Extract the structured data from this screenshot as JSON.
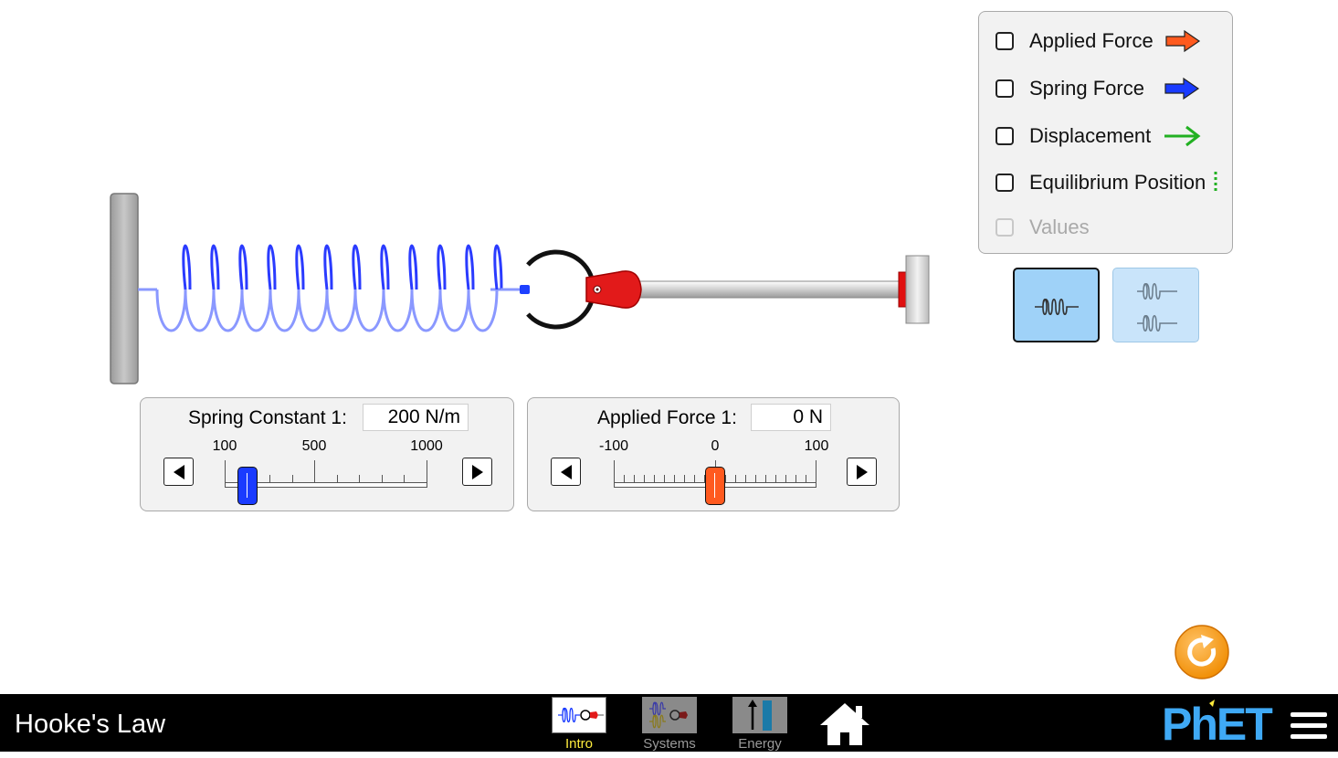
{
  "options": {
    "applied_force": "Applied Force",
    "spring_force": "Spring Force",
    "displacement": "Displacement",
    "equilibrium_position": "Equilibrium Position",
    "values": "Values"
  },
  "spring_constant": {
    "title": "Spring Constant 1:",
    "value": "200 N/m",
    "tick_min": "100",
    "tick_mid": "500",
    "tick_max": "1000",
    "level": 200,
    "range": [
      100,
      1000
    ]
  },
  "applied_force": {
    "title": "Applied Force 1:",
    "value": "0 N",
    "tick_min": "-100",
    "tick_mid": "0",
    "tick_max": "100",
    "level": 0,
    "range": [
      -100,
      100
    ]
  },
  "navbar": {
    "sim_title": "Hooke's Law",
    "tabs": [
      {
        "label": "Intro",
        "active": true
      },
      {
        "label": "Systems",
        "active": false
      },
      {
        "label": "Energy",
        "active": false
      }
    ],
    "logo": "PhET"
  },
  "colors": {
    "applied_force": "#ff5a1f",
    "spring_force": "#1a3bff",
    "displacement": "#22b022",
    "equilibrium": "#22b022",
    "active_tab_label": "#ffec3d",
    "inactive_tab_label": "#9a9a9a",
    "logo_blue": "#3fa9f5",
    "reset_orange": "#f7941d"
  }
}
